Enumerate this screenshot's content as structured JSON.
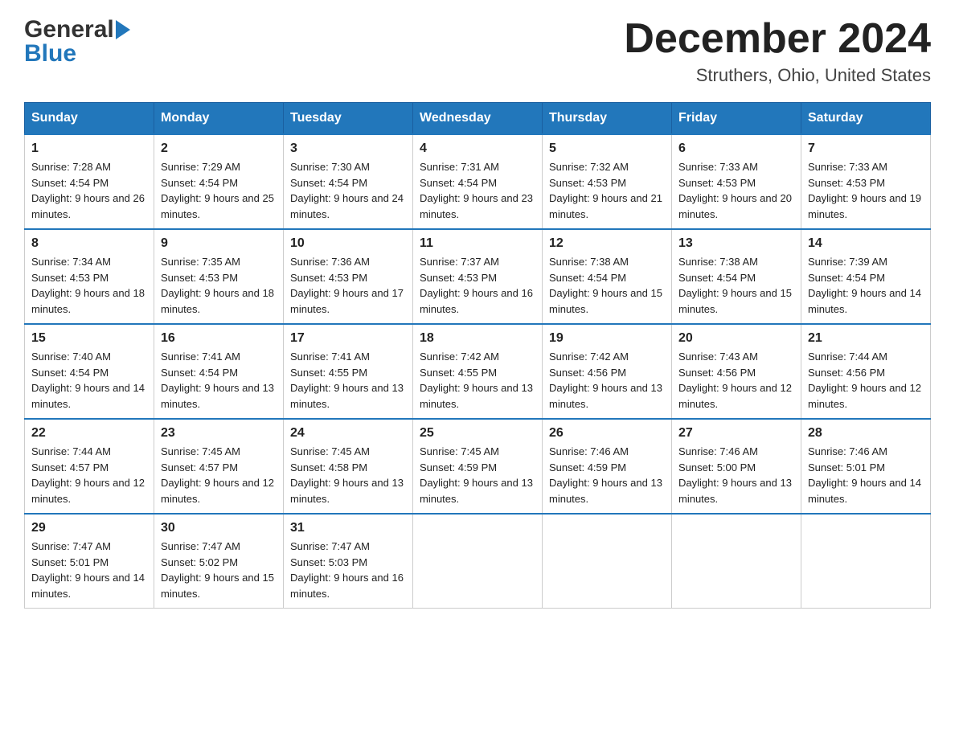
{
  "header": {
    "logo_general": "General",
    "logo_blue": "Blue",
    "month_title": "December 2024",
    "location": "Struthers, Ohio, United States"
  },
  "weekdays": [
    "Sunday",
    "Monday",
    "Tuesday",
    "Wednesday",
    "Thursday",
    "Friday",
    "Saturday"
  ],
  "weeks": [
    [
      {
        "day": "1",
        "sunrise": "7:28 AM",
        "sunset": "4:54 PM",
        "daylight": "9 hours and 26 minutes."
      },
      {
        "day": "2",
        "sunrise": "7:29 AM",
        "sunset": "4:54 PM",
        "daylight": "9 hours and 25 minutes."
      },
      {
        "day": "3",
        "sunrise": "7:30 AM",
        "sunset": "4:54 PM",
        "daylight": "9 hours and 24 minutes."
      },
      {
        "day": "4",
        "sunrise": "7:31 AM",
        "sunset": "4:54 PM",
        "daylight": "9 hours and 23 minutes."
      },
      {
        "day": "5",
        "sunrise": "7:32 AM",
        "sunset": "4:53 PM",
        "daylight": "9 hours and 21 minutes."
      },
      {
        "day": "6",
        "sunrise": "7:33 AM",
        "sunset": "4:53 PM",
        "daylight": "9 hours and 20 minutes."
      },
      {
        "day": "7",
        "sunrise": "7:33 AM",
        "sunset": "4:53 PM",
        "daylight": "9 hours and 19 minutes."
      }
    ],
    [
      {
        "day": "8",
        "sunrise": "7:34 AM",
        "sunset": "4:53 PM",
        "daylight": "9 hours and 18 minutes."
      },
      {
        "day": "9",
        "sunrise": "7:35 AM",
        "sunset": "4:53 PM",
        "daylight": "9 hours and 18 minutes."
      },
      {
        "day": "10",
        "sunrise": "7:36 AM",
        "sunset": "4:53 PM",
        "daylight": "9 hours and 17 minutes."
      },
      {
        "day": "11",
        "sunrise": "7:37 AM",
        "sunset": "4:53 PM",
        "daylight": "9 hours and 16 minutes."
      },
      {
        "day": "12",
        "sunrise": "7:38 AM",
        "sunset": "4:54 PM",
        "daylight": "9 hours and 15 minutes."
      },
      {
        "day": "13",
        "sunrise": "7:38 AM",
        "sunset": "4:54 PM",
        "daylight": "9 hours and 15 minutes."
      },
      {
        "day": "14",
        "sunrise": "7:39 AM",
        "sunset": "4:54 PM",
        "daylight": "9 hours and 14 minutes."
      }
    ],
    [
      {
        "day": "15",
        "sunrise": "7:40 AM",
        "sunset": "4:54 PM",
        "daylight": "9 hours and 14 minutes."
      },
      {
        "day": "16",
        "sunrise": "7:41 AM",
        "sunset": "4:54 PM",
        "daylight": "9 hours and 13 minutes."
      },
      {
        "day": "17",
        "sunrise": "7:41 AM",
        "sunset": "4:55 PM",
        "daylight": "9 hours and 13 minutes."
      },
      {
        "day": "18",
        "sunrise": "7:42 AM",
        "sunset": "4:55 PM",
        "daylight": "9 hours and 13 minutes."
      },
      {
        "day": "19",
        "sunrise": "7:42 AM",
        "sunset": "4:56 PM",
        "daylight": "9 hours and 13 minutes."
      },
      {
        "day": "20",
        "sunrise": "7:43 AM",
        "sunset": "4:56 PM",
        "daylight": "9 hours and 12 minutes."
      },
      {
        "day": "21",
        "sunrise": "7:44 AM",
        "sunset": "4:56 PM",
        "daylight": "9 hours and 12 minutes."
      }
    ],
    [
      {
        "day": "22",
        "sunrise": "7:44 AM",
        "sunset": "4:57 PM",
        "daylight": "9 hours and 12 minutes."
      },
      {
        "day": "23",
        "sunrise": "7:45 AM",
        "sunset": "4:57 PM",
        "daylight": "9 hours and 12 minutes."
      },
      {
        "day": "24",
        "sunrise": "7:45 AM",
        "sunset": "4:58 PM",
        "daylight": "9 hours and 13 minutes."
      },
      {
        "day": "25",
        "sunrise": "7:45 AM",
        "sunset": "4:59 PM",
        "daylight": "9 hours and 13 minutes."
      },
      {
        "day": "26",
        "sunrise": "7:46 AM",
        "sunset": "4:59 PM",
        "daylight": "9 hours and 13 minutes."
      },
      {
        "day": "27",
        "sunrise": "7:46 AM",
        "sunset": "5:00 PM",
        "daylight": "9 hours and 13 minutes."
      },
      {
        "day": "28",
        "sunrise": "7:46 AM",
        "sunset": "5:01 PM",
        "daylight": "9 hours and 14 minutes."
      }
    ],
    [
      {
        "day": "29",
        "sunrise": "7:47 AM",
        "sunset": "5:01 PM",
        "daylight": "9 hours and 14 minutes."
      },
      {
        "day": "30",
        "sunrise": "7:47 AM",
        "sunset": "5:02 PM",
        "daylight": "9 hours and 15 minutes."
      },
      {
        "day": "31",
        "sunrise": "7:47 AM",
        "sunset": "5:03 PM",
        "daylight": "9 hours and 16 minutes."
      },
      null,
      null,
      null,
      null
    ]
  ]
}
